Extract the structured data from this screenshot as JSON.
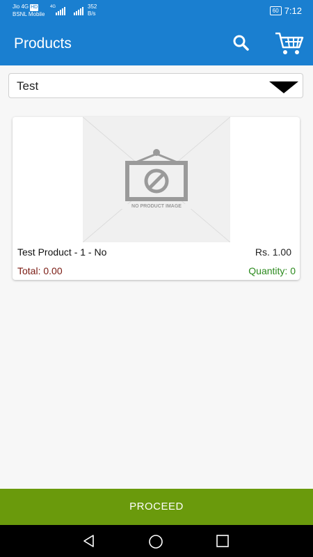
{
  "status_bar": {
    "carrier_line1": "Jio 4G",
    "carrier_badge": "HD",
    "carrier_line2": "BSNL Mobile",
    "network_type": "4G",
    "speed_value": "352",
    "speed_unit": "B/s",
    "battery": "60",
    "time": "7:12"
  },
  "app_bar": {
    "title": "Products",
    "search_icon": "search-icon",
    "cart_icon": "cart-icon"
  },
  "filter": {
    "selected": "Test"
  },
  "products": [
    {
      "name": "Test Product - 1 - No",
      "price": "Rs. 1.00",
      "total": "Total: 0.00",
      "quantity": "Quantity: 0",
      "image_caption": "NO PRODUCT IMAGE"
    }
  ],
  "footer": {
    "proceed_label": "PROCEED"
  },
  "colors": {
    "primary": "#1a7fd0",
    "proceed": "#6a9a0c",
    "total": "#7a1a12",
    "quantity": "#2c8a1e"
  }
}
